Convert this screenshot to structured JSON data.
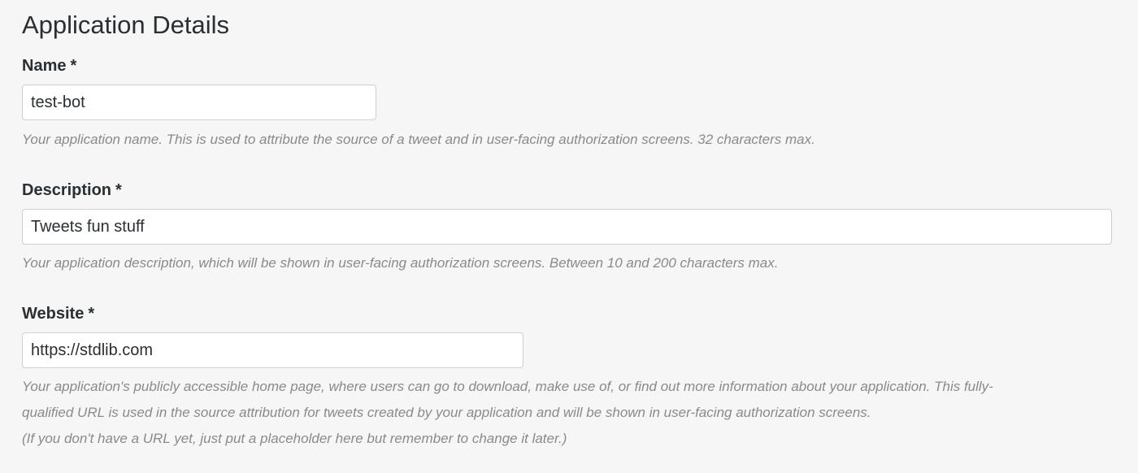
{
  "page": {
    "title": "Application Details"
  },
  "fields": {
    "name": {
      "label": "Name",
      "required_marker": "*",
      "value": "test-bot",
      "help": "Your application name. This is used to attribute the source of a tweet and in user-facing authorization screens. 32 characters max."
    },
    "description": {
      "label": "Description",
      "required_marker": "*",
      "value": "Tweets fun stuff",
      "help": "Your application description, which will be shown in user-facing authorization screens. Between 10 and 200 characters max."
    },
    "website": {
      "label": "Website",
      "required_marker": "*",
      "value": "https://stdlib.com",
      "help_lines": [
        "Your application's publicly accessible home page, where users can go to download, make use of, or find out more information about your application. This fully-",
        "qualified URL is used in the source attribution for tweets created by your application and will be shown in user-facing authorization screens.",
        "(If you don't have a URL yet, just put a placeholder here but remember to change it later.)"
      ]
    }
  }
}
